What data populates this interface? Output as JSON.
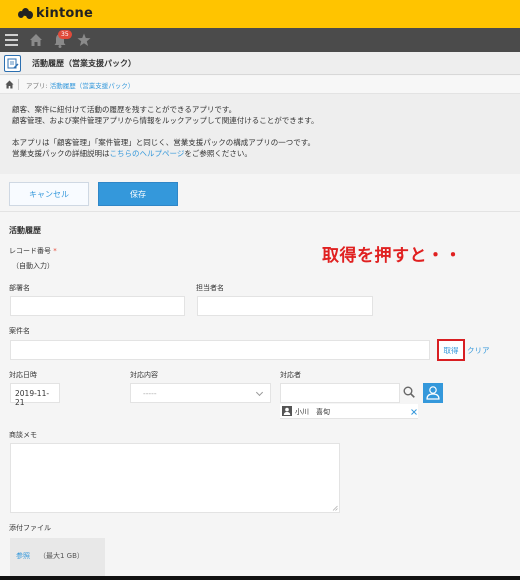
{
  "brand": {
    "name": "kintone"
  },
  "nav": {
    "notification_count": "35"
  },
  "app": {
    "title": "活動履歴（営業支援パック）"
  },
  "breadcrumb": {
    "prefix": "アプリ:",
    "link": "活動履歴（営業支援パック）"
  },
  "description": {
    "line1": "顧客、案件に紐付けて活動の履歴を残すことができるアプリです。",
    "line2": "顧客管理、および案件管理アプリから情報をルックアップして関連付けることができます。",
    "line3": "本アプリは「顧客管理」「案件管理」と同じく、営業支援パックの構成アプリの一つです。",
    "line4_before": "営業支援パックの詳細説明は",
    "line4_link": "こちらのヘルプページ",
    "line4_after": "をご参照ください。"
  },
  "toolbar": {
    "cancel_label": "キャンセル",
    "save_label": "保存"
  },
  "form": {
    "section": "活動履歴",
    "record_number_label": "レコード番号",
    "record_number_required": "*",
    "record_number_value": "（自動入力）",
    "department_label": "部署名",
    "contact_label": "担当者名",
    "case_label": "案件名",
    "fetch_label": "取得",
    "clear_label": "クリア",
    "date_label": "対応日時",
    "date_value": "2019-11-21",
    "content_label": "対応内容",
    "content_value": "-----",
    "responder_label": "対応者",
    "responder_name": "小川　喜旬",
    "memo_label": "商談メモ",
    "attachment_label": "添付ファイル",
    "browse_label": "参照",
    "max_size": "（最大1 GB）"
  },
  "annotation": {
    "text": "取得を押すと・・"
  },
  "colors": {
    "brand_yellow": "#ffc400",
    "accent_blue": "#3498db",
    "highlight_red": "#d81e22"
  }
}
